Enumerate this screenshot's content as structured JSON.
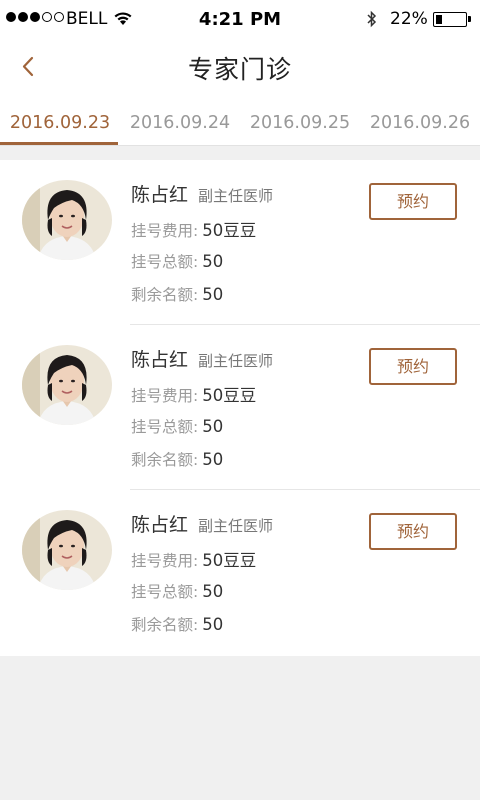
{
  "status_bar": {
    "carrier": "BELL",
    "time": "4:21 PM",
    "battery": "22%",
    "battery_level": 0.22
  },
  "nav": {
    "title": "专家门诊",
    "back_icon": "chevron-left-icon"
  },
  "tabs": [
    {
      "label": "2016.09.23",
      "active": true
    },
    {
      "label": "2016.09.24",
      "active": false
    },
    {
      "label": "2016.09.25",
      "active": false
    },
    {
      "label": "2016.09.26",
      "active": false
    }
  ],
  "labels": {
    "fee": "挂号费用:",
    "total": "挂号总额:",
    "remaining": "剩余名额:",
    "book": "预约"
  },
  "doctors": [
    {
      "name": "陈占红",
      "rank": "副主任医师",
      "fee": "50豆豆",
      "total": "50",
      "remaining": "50"
    },
    {
      "name": "陈占红",
      "rank": "副主任医师",
      "fee": "50豆豆",
      "total": "50",
      "remaining": "50"
    },
    {
      "name": "陈占红",
      "rank": "副主任医师",
      "fee": "50豆豆",
      "total": "50",
      "remaining": "50"
    }
  ],
  "colors": {
    "accent": "#a0643a",
    "background": "#f0f0f0"
  }
}
